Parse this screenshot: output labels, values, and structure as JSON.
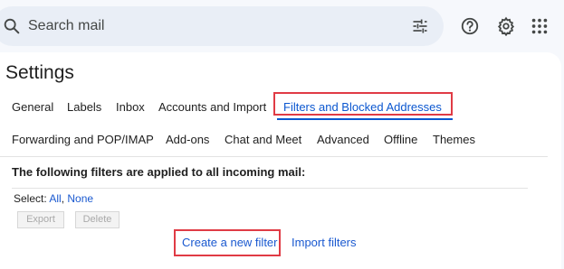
{
  "search": {
    "placeholder": "Search mail",
    "search_icon": "search-icon",
    "options_icon": "tune-icon"
  },
  "header_icons": [
    "help-icon",
    "gear-icon",
    "apps-grid-icon"
  ],
  "settings": {
    "title": "Settings",
    "tabs_row1": [
      "General",
      "Labels",
      "Inbox",
      "Accounts and Import",
      "Filters and Blocked Addresses"
    ],
    "tabs_row2": [
      "Forwarding and POP/IMAP",
      "Add-ons",
      "Chat and Meet",
      "Advanced",
      "Offline",
      "Themes"
    ],
    "active_tab": "Filters and Blocked Addresses"
  },
  "filters": {
    "heading": "The following filters are applied to all incoming mail:",
    "select_label": "Select:",
    "select_all": "All",
    "select_sep": ",",
    "select_none": "None",
    "export_label": "Export",
    "delete_label": "Delete",
    "create_filter": "Create a new filter",
    "import_filters": "Import filters"
  },
  "colors": {
    "accent": "#0b57d0",
    "link": "#1a59d0",
    "highlight": "#e03b45",
    "search_bg": "#e9eef6"
  }
}
